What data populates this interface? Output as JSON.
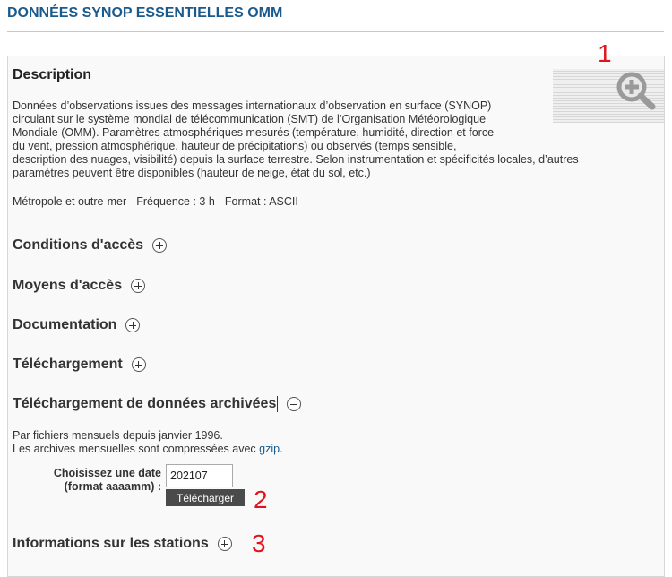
{
  "page": {
    "title": "DONNÉES SYNOP ESSENTIELLES OMM"
  },
  "description": {
    "heading": "Description",
    "thumbnail_icon": "zoom-in-icon",
    "lines": [
      "Données d’observations issues des messages internationaux d’observation en surface (SYNOP)",
      "circulant sur le système mondial de télécommunication (SMT) de l’Organisation Météorologique",
      "Mondiale (OMM). Paramètres atmosphériques mesurés (température, humidité, direction et force",
      "du vent, pression atmosphérique, hauteur de précipitations) ou observés (temps sensible,",
      "description des nuages, visibilité) depuis la surface terrestre. Selon instrumentation et spécificités locales, d’autres",
      "paramètres peuvent être disponibles (hauteur de neige, état du sol, etc.)"
    ],
    "meta": "Métropole et outre-mer - Fréquence : 3 h - Format : ASCII"
  },
  "sections": {
    "conditions": "Conditions d'accès",
    "moyens": "Moyens d'accès",
    "documentation": "Documentation",
    "telechargement": "Téléchargement",
    "archives": "Téléchargement de données archivées",
    "stations": "Informations sur les stations"
  },
  "archives": {
    "line1": "Par fichiers mensuels depuis janvier 1996.",
    "line2_prefix": "Les archives mensuelles sont compressées avec ",
    "link": "gzip",
    "line2_suffix": ".",
    "form_label_line1": "Choisissez une date",
    "form_label_line2": "(format aaaamm) :",
    "date_value": "202107",
    "button_label": "Télécharger"
  },
  "annotations": {
    "marker1": "1",
    "marker2": "2",
    "marker3": "3",
    "color": "#e1141c"
  },
  "colors": {
    "title": "#1a5a8c",
    "link": "#1a5a8c",
    "button": "#4a4a4a"
  }
}
